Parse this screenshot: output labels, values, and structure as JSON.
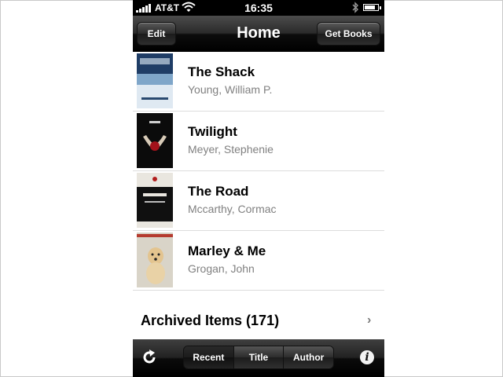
{
  "status_bar": {
    "carrier": "AT&T",
    "time": "16:35",
    "signal_icon": "signal-bars-icon",
    "wifi_icon": "wifi-icon",
    "bluetooth_icon": "bluetooth-icon",
    "battery_icon": "battery-icon",
    "battery_level": 0.8
  },
  "navbar": {
    "title": "Home",
    "edit_label": "Edit",
    "get_books_label": "Get Books"
  },
  "books": [
    {
      "title": "The Shack",
      "author": "Young, William P."
    },
    {
      "title": "Twilight",
      "author": "Meyer, Stephenie"
    },
    {
      "title": "The Road",
      "author": "Mccarthy, Cormac"
    },
    {
      "title": "Marley & Me",
      "author": "Grogan, John"
    }
  ],
  "archived": {
    "label": "Archived Items (171)",
    "chevron_icon": "chevron-right-icon"
  },
  "toolbar": {
    "refresh_icon": "refresh-icon",
    "segments": [
      "Recent",
      "Title",
      "Author"
    ],
    "selected_segment": "Recent",
    "info_icon": "info-icon"
  },
  "colors": {
    "bar_dark": "#1a1a1a",
    "author_gray": "#808080",
    "separator": "#dcdcdc"
  }
}
